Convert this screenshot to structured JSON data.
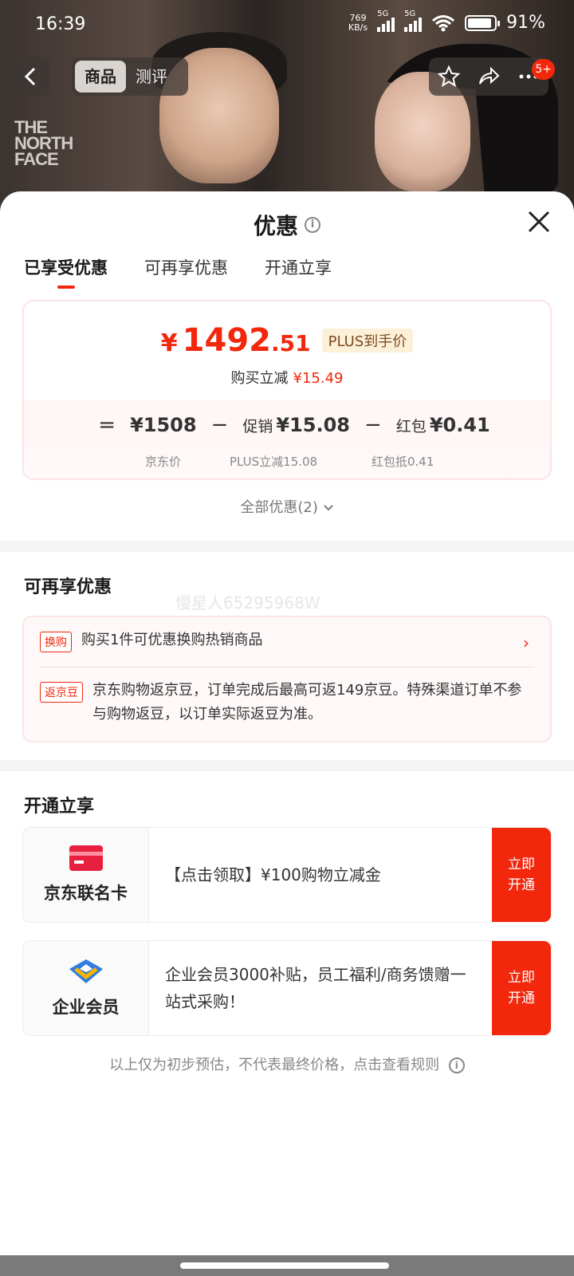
{
  "status_bar": {
    "time": "16:39",
    "net_speed_top": "769",
    "net_speed_bottom": "KB/s",
    "signal_tag_1": "5G",
    "signal_tag_2": "5G",
    "battery_percent": "91%",
    "battery_level": 0.91
  },
  "nav": {
    "tabs": [
      "商品",
      "测评"
    ],
    "active_tab": "商品",
    "badge": "5+"
  },
  "background": {
    "brand_line1": "THE",
    "brand_line2": "NORTH",
    "brand_line3": "FACE"
  },
  "sheet": {
    "title": "优惠",
    "tabs": [
      "已享受优惠",
      "可再享优惠",
      "开通立享"
    ],
    "active_tab_index": 0,
    "price": {
      "yen": "¥",
      "integer": "1492",
      "decimal": ".51",
      "plus_tag": "PLUS到手价",
      "save_label": "购买立减",
      "save_value": "¥15.49",
      "eq": "=",
      "base_value": "¥1508",
      "op1": "−",
      "promo_label": "促销",
      "promo_value": "¥15.08",
      "op2": "−",
      "redpack_label": "红包",
      "redpack_value": "¥0.41",
      "base_sub": "京东价",
      "promo_sub": "PLUS立减15.08",
      "redpack_sub": "红包抵0.41"
    },
    "all_offers": "全部优惠(2)",
    "more_section": {
      "title": "可再享优惠",
      "watermark": "慢星人65295968W",
      "items": [
        {
          "tag": "换购",
          "text": "购买1件可优惠换购热销商品",
          "arrow": "›"
        },
        {
          "tag": "返京豆",
          "text": "京东购物返京豆，订单完成后最高可返149京豆。特殊渠道订单不参与购物返豆，以订单实际返豆为准。"
        }
      ]
    },
    "open_section": {
      "title": "开通立享",
      "cards": [
        {
          "name": "京东联名卡",
          "desc": "【点击领取】¥100购物立减金",
          "button": "立即开通"
        },
        {
          "name": "企业会员",
          "desc": " 企业会员3000补贴，员工福利/商务馈赠一站式采购！",
          "button": "立即开通"
        }
      ]
    },
    "footnote": "以上仅为初步预估，不代表最终价格，点击查看规则"
  }
}
